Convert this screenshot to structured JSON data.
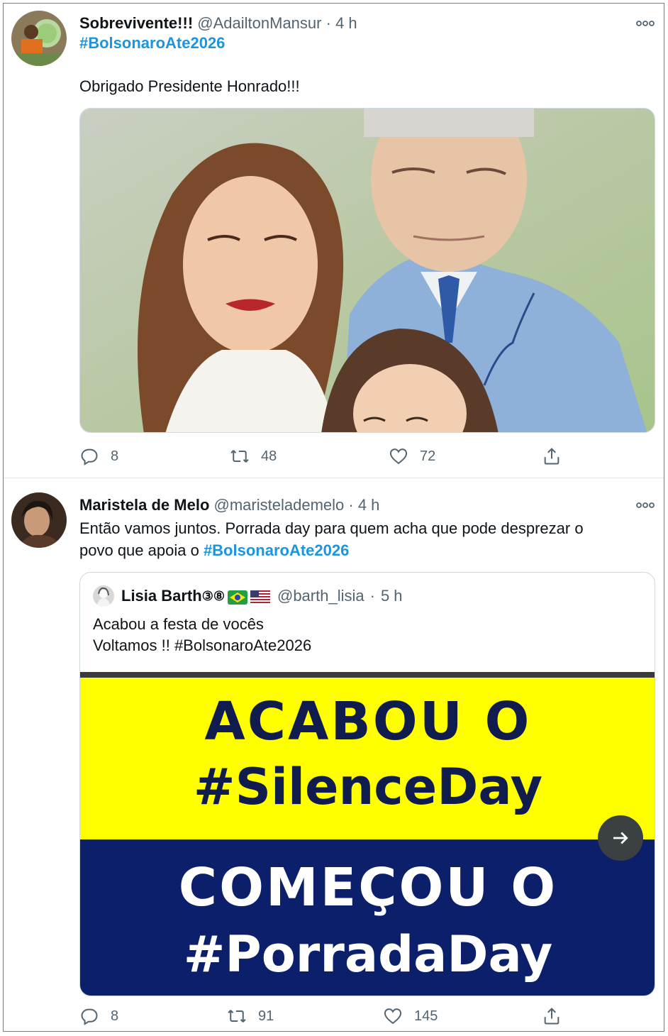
{
  "tweets": [
    {
      "display_name": "Sobrevivente!!!",
      "handle": "@AdailtonMansur",
      "separator": "·",
      "time": "4 h",
      "hashtag_line": "#BolsonaroAte2026",
      "text": "Obrigado Presidente Honrado!!!",
      "media_description": "painting",
      "actions": {
        "replies": "8",
        "retweets": "48",
        "likes": "72"
      }
    },
    {
      "display_name": "Maristela de Melo",
      "handle": "@mariste­lademelo",
      "separator": "·",
      "time": "4 h",
      "text_part1": "Então vamos juntos. Porrada day para quem acha que pode desprezar o",
      "text_part2": "povo que apoia o ",
      "text_hashtag": "#BolsonaroAte2026",
      "quote": {
        "display_name": "Lisia Barth",
        "badges": "③⑧",
        "handle": "@barth_lisia",
        "separator": "·",
        "time": "5 h",
        "line1": "Acabou a festa de vocês",
        "line2": "Voltamos !! #BolsonaroAte2026",
        "banner": {
          "line1": "ACABOU O",
          "line2": "#SilenceDay",
          "line3": "COMEÇOU O",
          "line4": "#PorradaDay"
        }
      },
      "actions": {
        "replies": "8",
        "retweets": "91",
        "likes": "145"
      }
    }
  ],
  "colors": {
    "hashtag": "#1b95e0",
    "muted": "#536471",
    "banner_yellow": "#ffff00",
    "banner_navy": "#0b1f6b"
  },
  "icons": [
    "more-icon",
    "reply-icon",
    "retweet-icon",
    "like-icon",
    "share-icon",
    "arrow-right-icon"
  ]
}
